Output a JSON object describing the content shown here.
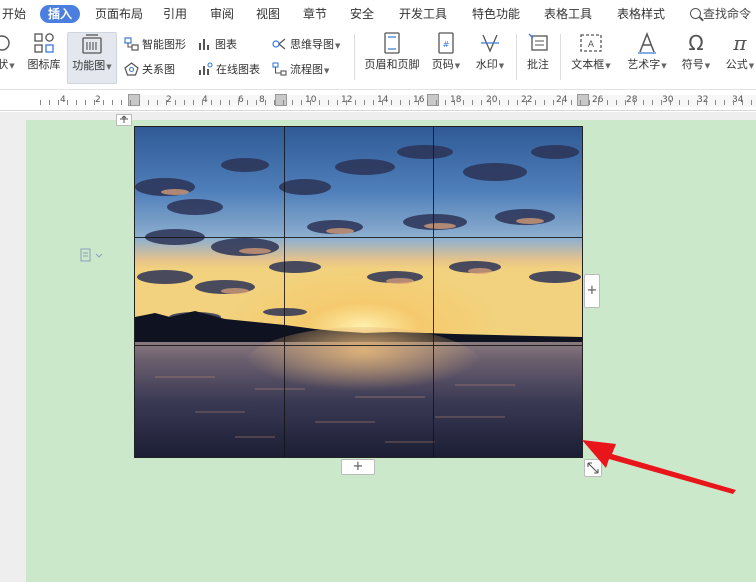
{
  "menu": {
    "tabs": [
      "开始",
      "插入",
      "页面布局",
      "引用",
      "审阅",
      "视图",
      "章节",
      "安全",
      "开发工具",
      "特色功能",
      "表格工具",
      "表格样式"
    ],
    "active_tab": "插入",
    "search_label": "查找命令"
  },
  "ribbon": {
    "shape_label": "状",
    "icon_library_label": "图标库",
    "function_chart_label": "功能图",
    "smart_graphic_label": "智能图形",
    "chart_label": "图表",
    "relation_chart_label": "关系图",
    "online_chart_label": "在线图表",
    "mind_map_label": "思维导图",
    "flowchart_label": "流程图",
    "header_footer_label": "页眉和页脚",
    "page_number_label": "页码",
    "watermark_label": "水印",
    "comment_label": "批注",
    "textbox_label": "文本框",
    "wordart_label": "艺术字",
    "symbol_label": "符号",
    "formula_label": "公式"
  },
  "ruler": {
    "labels": [
      "4",
      "2",
      "2",
      "4",
      "6",
      "8",
      "10",
      "12",
      "14",
      "16",
      "18",
      "20",
      "22",
      "24",
      "26",
      "28",
      "30",
      "32",
      "34"
    ]
  },
  "document": {
    "add_column_symbol": "+",
    "add_row_symbol": "+"
  },
  "colors": {
    "accent": "#4a7fe0",
    "page_background": "#cbe8cb",
    "arrow": "#e8161b"
  },
  "icons": [
    "search-icon",
    "shape-icon",
    "icon-library-icon",
    "function-chart-icon",
    "smart-graphic-icon",
    "chart-icon",
    "relation-chart-icon",
    "online-chart-icon",
    "mind-map-icon",
    "flowchart-icon",
    "header-footer-icon",
    "page-number-icon",
    "watermark-icon",
    "comment-icon",
    "textbox-icon",
    "wordart-icon",
    "symbol-icon",
    "formula-icon",
    "paragraph-icon",
    "resize-icon",
    "move-icon",
    "red-arrow"
  ]
}
